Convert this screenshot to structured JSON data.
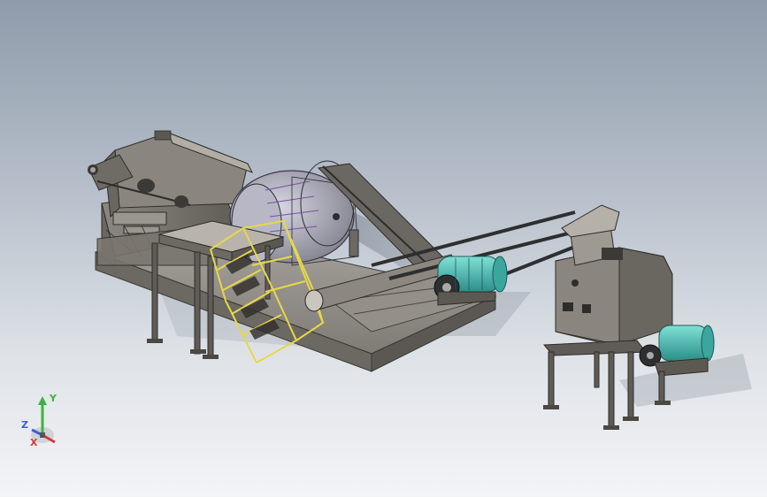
{
  "viewport": {
    "background_top": "#8f9bab",
    "background_bottom": "#f3f4f6"
  },
  "model": {
    "steel_color": "#7d7a75",
    "ladder_color": "#e6d84a",
    "motor_color": "#49b9b0",
    "belt_color": "#2d2f31"
  },
  "triad": {
    "x_label": "X",
    "y_label": "Y",
    "z_label": "Z",
    "x_color": "#d33a3a",
    "y_color": "#3fb23f",
    "z_color": "#3f5fd0"
  }
}
